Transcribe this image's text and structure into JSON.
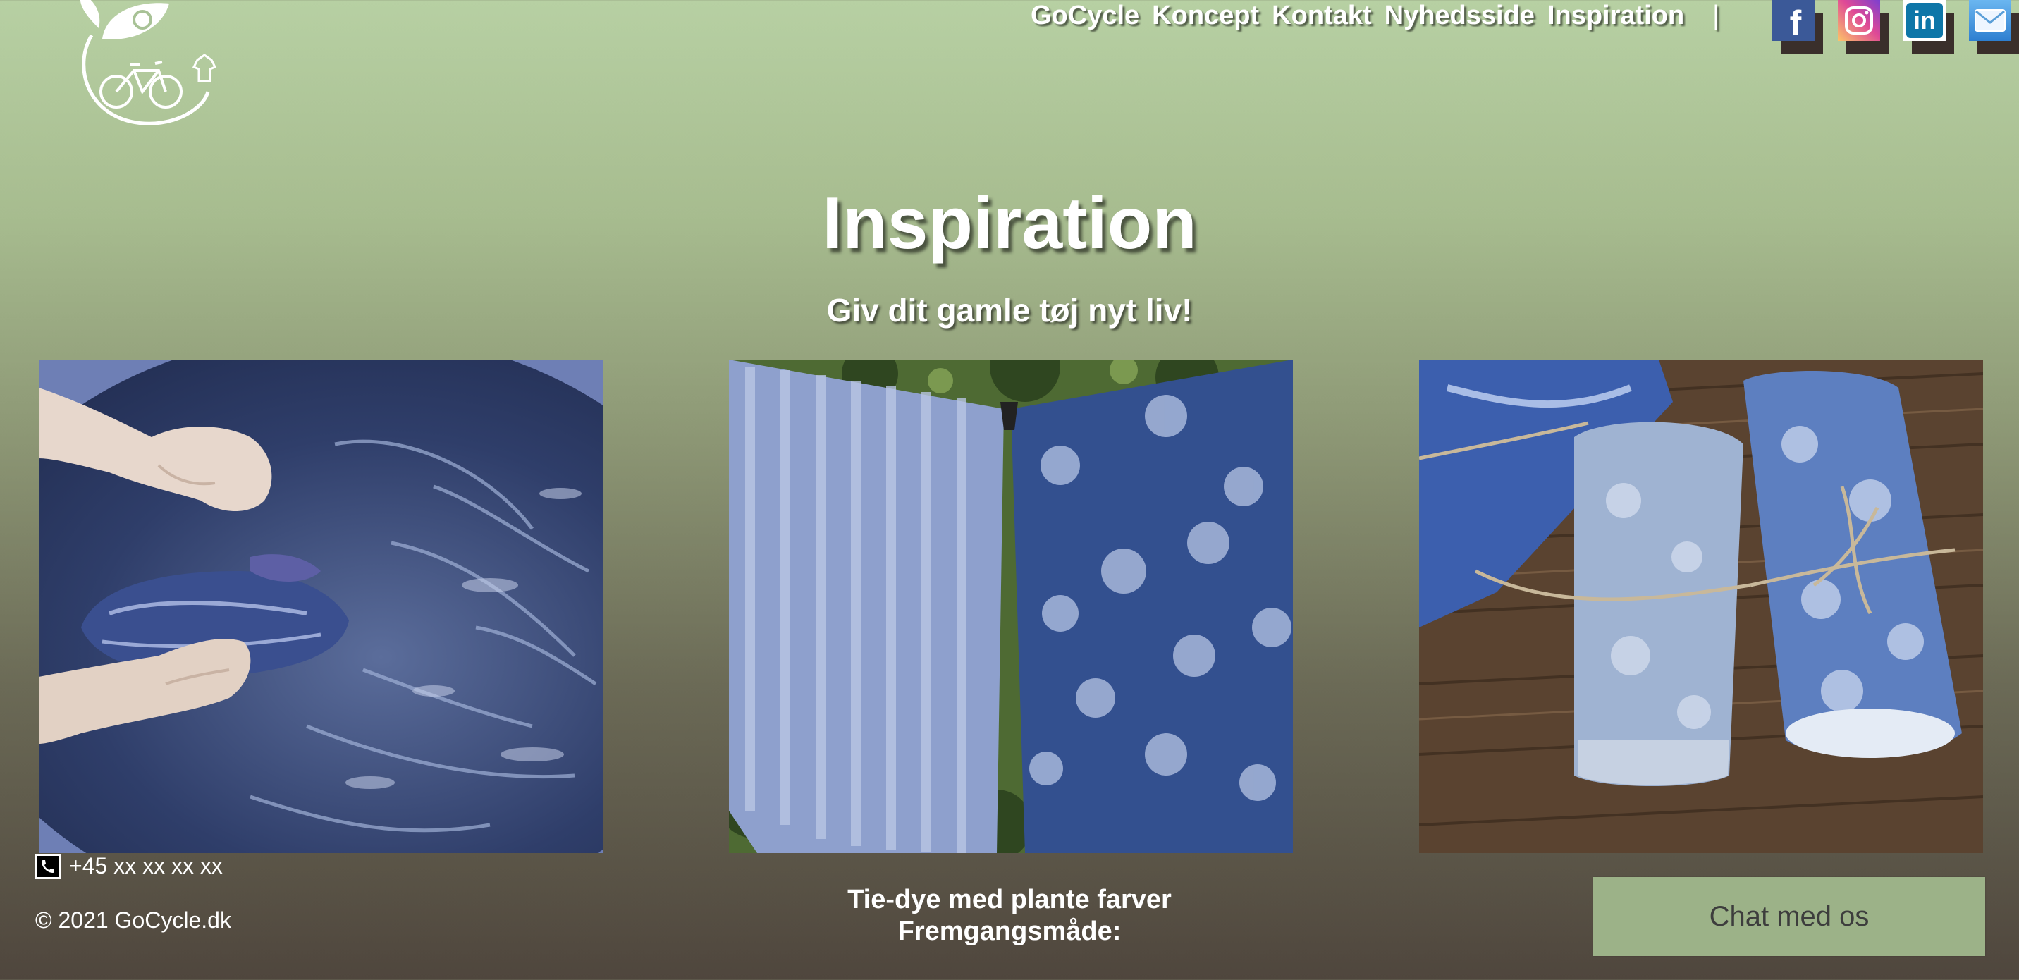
{
  "header": {
    "logo_icon": "gocycle-logo-icon",
    "nav": [
      {
        "label": "GoCycle"
      },
      {
        "label": "Koncept"
      },
      {
        "label": "Kontakt"
      },
      {
        "label": "Nyhedsside"
      },
      {
        "label": "Inspiration"
      }
    ],
    "separator": "|",
    "social": [
      {
        "icon": "facebook-icon",
        "color": "#3b5998"
      },
      {
        "icon": "instagram-icon",
        "color": "#d6249f"
      },
      {
        "icon": "linkedin-icon",
        "color": "#0e76a8"
      },
      {
        "icon": "mail-icon",
        "color": "#3f8fd8"
      }
    ]
  },
  "main": {
    "title": "Inspiration",
    "subtitle": "Giv dit gamle tøj nyt liv!",
    "images": [
      {
        "icon": "dyeing-hands-photo"
      },
      {
        "icon": "hanging-cloth-photo"
      },
      {
        "icon": "rolled-fabric-photo"
      }
    ],
    "caption_line1": "Tie-dye med plante farver",
    "caption_line2": "Fremgangsmåde:"
  },
  "footer": {
    "phone": "+45 xx xx xx xx",
    "copyright": "© 2021 GoCycle.dk",
    "chat_label": "Chat med os"
  },
  "colors": {
    "accent_green": "#9cb288",
    "background_top": "#b7d0a3",
    "background_bottom": "#4f463d"
  }
}
